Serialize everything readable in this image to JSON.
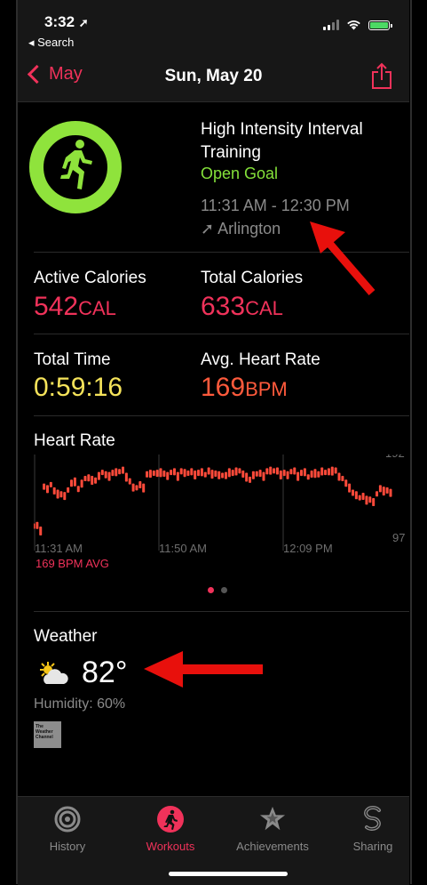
{
  "status": {
    "time": "3:32",
    "back_app": "◂ Search"
  },
  "nav": {
    "back_label": "May",
    "title": "Sun, May 20"
  },
  "workout": {
    "title": "High Intensity Interval Training",
    "goal": "Open Goal",
    "time_range": "11:31 AM - 12:30 PM",
    "location": "➚ Arlington"
  },
  "metrics": {
    "active_calories_label": "Active Calories",
    "active_calories_value": "542",
    "active_calories_unit": "CAL",
    "total_calories_label": "Total Calories",
    "total_calories_value": "633",
    "total_calories_unit": "CAL",
    "total_time_label": "Total Time",
    "total_time_value": "0:59:16",
    "avg_hr_label": "Avg. Heart Rate",
    "avg_hr_value": "169",
    "avg_hr_unit": "BPM"
  },
  "chart_data": {
    "type": "scatter",
    "title": "Heart Rate",
    "x_ticks": [
      "11:31 AM",
      "11:50 AM",
      "12:09 PM"
    ],
    "y_max_label": "192",
    "y_min_label": "97",
    "ylim": [
      97,
      192
    ],
    "avg_label": "169 BPM AVG",
    "color": "#ff4a3a",
    "values": [
      108,
      110,
      104,
      160,
      158,
      162,
      155,
      152,
      150,
      149,
      155,
      165,
      168,
      157,
      165,
      170,
      172,
      170,
      168,
      175,
      178,
      176,
      175,
      178,
      180,
      179,
      182,
      174,
      167,
      160,
      158,
      163,
      160,
      176,
      178,
      177,
      178,
      180,
      177,
      175,
      178,
      180,
      175,
      180,
      179,
      177,
      180,
      177,
      178,
      180,
      175,
      181,
      178,
      177,
      176,
      174,
      175,
      180,
      178,
      181,
      180,
      177,
      174,
      169,
      176,
      176,
      178,
      175,
      180,
      182,
      180,
      181,
      177,
      178,
      176,
      179,
      181,
      175,
      178,
      180,
      172,
      177,
      179,
      176,
      181,
      178,
      180,
      182,
      181,
      174,
      170,
      165,
      160,
      152,
      150,
      145,
      148,
      144,
      143,
      141,
      150,
      158,
      156,
      155,
      153
    ]
  },
  "pager": {
    "count": 2,
    "active": 0
  },
  "weather": {
    "label": "Weather",
    "temp": "82°",
    "humidity": "Humidity: 60%",
    "logo_text": "The Weather Channel"
  },
  "tabs": [
    {
      "label": "History",
      "icon": "history-icon"
    },
    {
      "label": "Workouts",
      "icon": "workouts-icon"
    },
    {
      "label": "Achievements",
      "icon": "achievements-icon"
    },
    {
      "label": "Sharing",
      "icon": "sharing-icon"
    }
  ],
  "colors": {
    "accent": "#f0325a",
    "goal_green": "#84e13a",
    "time_yellow": "#f5e35a",
    "hr_orange": "#ff5a3c",
    "annotation_red": "#e8100c"
  }
}
